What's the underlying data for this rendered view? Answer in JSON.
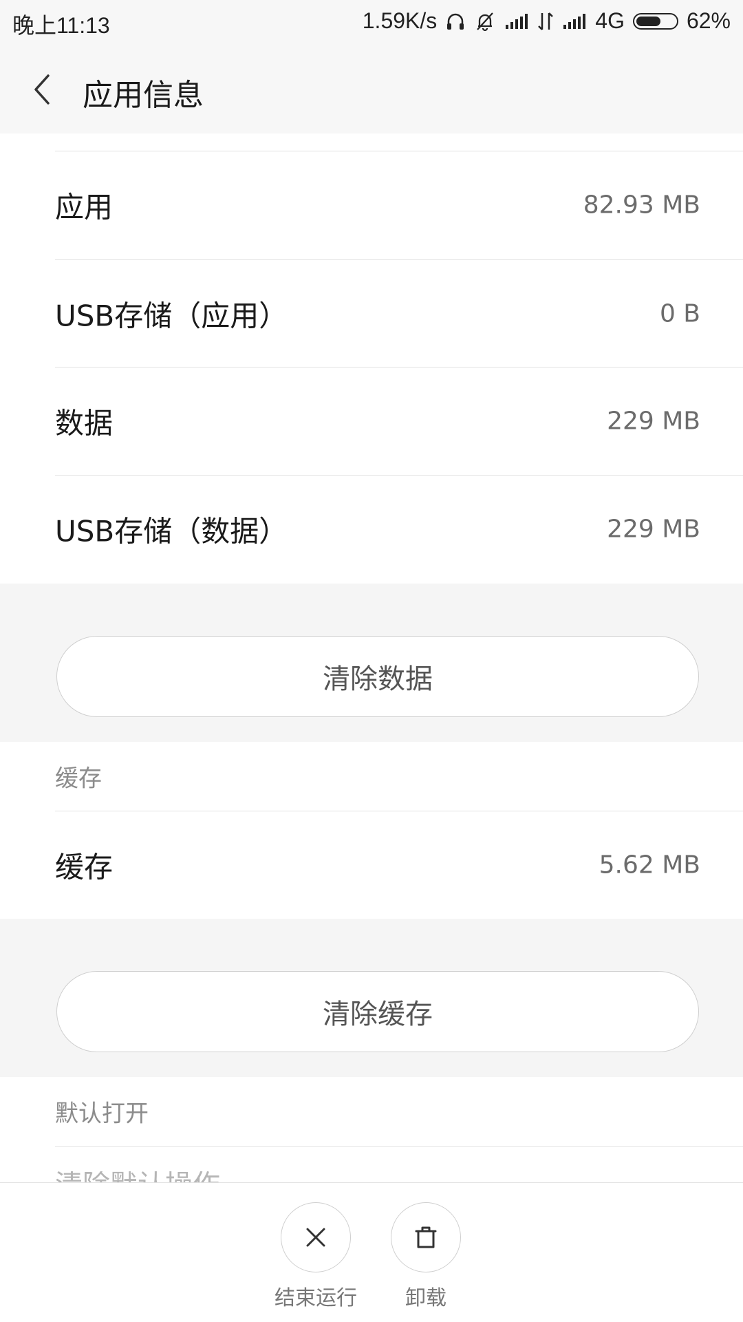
{
  "status_bar": {
    "time": "晚上11:13",
    "network_speed": "1.59K/s",
    "network_type": "4G",
    "battery": "62%",
    "battery_level": 0.62
  },
  "header": {
    "title": "应用信息"
  },
  "storage_rows": [
    {
      "label": "应用",
      "value": "82.93 MB"
    },
    {
      "label": "USB存储（应用）",
      "value": "0 B"
    },
    {
      "label": "数据",
      "value": "229 MB"
    },
    {
      "label": "USB存储（数据）",
      "value": "229 MB"
    }
  ],
  "clear_data_button": "清除数据",
  "cache_section": {
    "header": "缓存",
    "row": {
      "label": "缓存",
      "value": "5.62 MB"
    },
    "clear_button": "清除缓存"
  },
  "default_open_section": {
    "header": "默认打开",
    "peek_text": "清除默认操作"
  },
  "bottom_actions": [
    {
      "label": "结束运行",
      "icon": "close-icon"
    },
    {
      "label": "卸载",
      "icon": "trash-icon"
    }
  ]
}
